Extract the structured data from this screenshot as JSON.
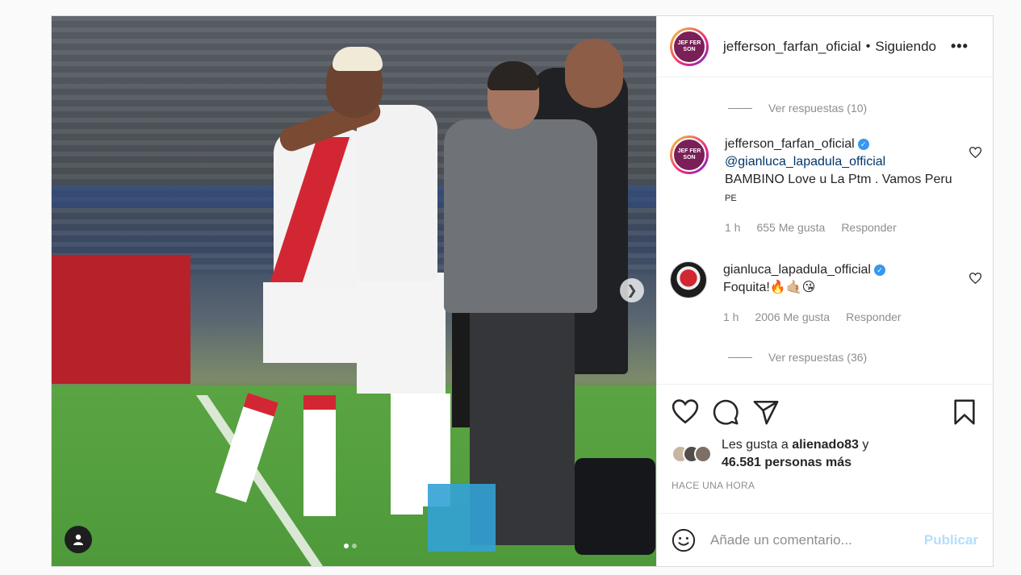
{
  "header": {
    "username": "jefferson_farfan_oficial",
    "separator": "•",
    "follow_status": "Siguiendo",
    "more": "•••",
    "avatar_text": "JEF FER SON"
  },
  "media": {
    "next_icon": "chevron-right-icon",
    "tag_icon": "user-icon",
    "slide_count": 2,
    "current_slide": 1
  },
  "comments": {
    "view_replies_1": "Ver respuestas (10)",
    "items": [
      {
        "username": "jefferson_farfan_oficial",
        "mention": "@gianluca_lapadula_official",
        "text": "BAMBINO Love u La Ptm . Vamos Peru",
        "flag": "PE",
        "time": "1 h",
        "likes": "655 Me gusta",
        "reply": "Responder"
      },
      {
        "username": "gianluca_lapadula_official",
        "text": "Foquita!🔥🤙🏼😘",
        "time": "1 h",
        "likes": "2006 Me gusta",
        "reply": "Responder"
      }
    ],
    "view_replies_2": "Ver respuestas (36)"
  },
  "actions": {
    "liked_by_prefix": "Les gusta a",
    "liked_by_user": "alienado83",
    "liked_by_suffix": "y",
    "likes_count": "46.581 personas más",
    "time_ago": "HACE UNA HORA"
  },
  "add_comment": {
    "placeholder": "Añade un comentario...",
    "publish": "Publicar"
  },
  "colors": {
    "verified": "#3897f0",
    "publish_disabled": "#b2dffc",
    "border": "#dbdbdb"
  }
}
